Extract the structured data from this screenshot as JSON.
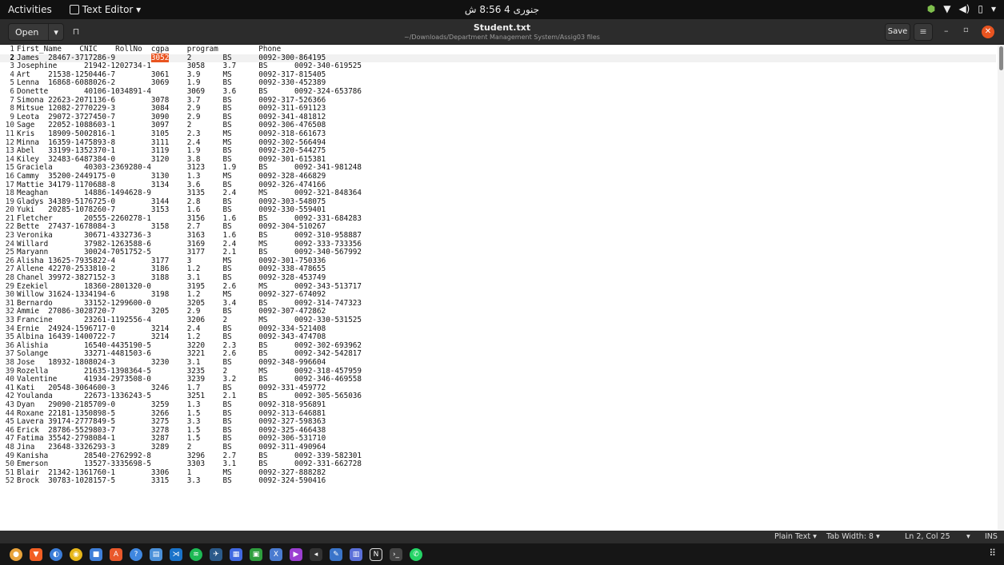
{
  "topbar": {
    "activities": "Activities",
    "app_name": "Text Editor ▾",
    "clock": "جنوری 4  8:56 ش",
    "tray_icons": [
      "shield-icon",
      "wifi-icon",
      "volume-icon",
      "battery-icon",
      "menu-arrow-icon"
    ]
  },
  "headerbar": {
    "open_label": "Open",
    "title": "Student.txt",
    "path": "~/Downloads/Department Management System/Assig03 files",
    "save_label": "Save"
  },
  "editor": {
    "lines": [
      "First_Name    CNIC    RollNo  cgpa    program         Phone",
      "James  28467-3717286-9        3052    2       BS      0092-300-864195",
      "Josephine      21942-1202734-1        3058    3.7     BS      0092-340-619525",
      "Art    21538-1250446-7        3061    3.9     MS      0092-317-815405",
      "Lenna  16868-6088026-2        3069    1.9     BS      0092-330-452389",
      "Donette        40106-1034891-4        3069    3.6     BS      0092-324-653786",
      "Simona 22623-2071136-6        3078    3.7     BS      0092-317-526366",
      "Mitsue 12082-2770229-3        3084    2.9     BS      0092-311-691123",
      "Leota  29072-3727450-7        3090    2.9     BS      0092-341-481812",
      "Sage   22052-1088603-1        3097    2       BS      0092-306-476508",
      "Kris   18909-5002816-1        3105    2.3     MS      0092-318-661673",
      "Minna  16359-1475893-8        3111    2.4     MS      0092-302-566494",
      "Abel   33199-1352370-1        3119    1.9     BS      0092-320-544275",
      "Kiley  32483-6487384-0        3120    3.8     BS      0092-301-615381",
      "Graciela       40303-2369280-4        3123    1.9     BS      0092-341-981248",
      "Cammy  35200-2449175-0        3130    1.3     MS      0092-328-466829",
      "Mattie 34179-1170688-8        3134    3.6     BS      0092-326-474166",
      "Meaghan        14886-1494628-9        3135    2.4     MS      0092-321-848364",
      "Gladys 34389-5176725-0        3144    2.8     BS      0092-303-548075",
      "Yuki   20285-1078260-7        3153    1.6     BS      0092-330-559401",
      "Fletcher       20555-2260278-1        3156    1.6     BS      0092-331-684283",
      "Bette  27437-1678084-3        3158    2.7     BS      0092-304-510267",
      "Veronika       30671-4332736-3        3163    1.6     BS      0092-310-958887",
      "Willard        37982-1263588-6        3169    2.4     MS      0092-333-733356",
      "Maryann        30024-7051752-5        3177    2.1     BS      0092-340-567992",
      "Alisha 13625-7935822-4        3177    3       MS      0092-301-750336",
      "Allene 42270-2533810-2        3186    1.2     BS      0092-338-478655",
      "Chanel 39972-3827152-3        3188    3.1     BS      0092-328-453749",
      "Ezekiel        18360-2801320-0        3195    2.6     MS      0092-343-513717",
      "Willow 31624-1334194-6        3198    1.2     MS      0092-327-674092",
      "Bernardo       33152-1299600-0        3205    3.4     BS      0092-314-747323",
      "Ammie  27086-3028720-7        3205    2.9     BS      0092-307-472862",
      "Francine       23261-1192556-4        3206    2       MS      0092-330-531525",
      "Ernie  24924-1596717-0        3214    2.4     BS      0092-334-521408",
      "Albina 16439-1400722-7        3214    1.2     BS      0092-343-474708",
      "Alishia        16540-4435190-5        3220    2.3     BS      0092-302-693962",
      "Solange        33271-4481503-6        3221    2.6     BS      0092-342-542817",
      "Jose   18932-1808024-3        3230    3.1     BS      0092-348-996604",
      "Rozella        21635-1398364-5        3235    2       MS      0092-318-457959",
      "Valentine      41934-2973508-0        3239    3.2     BS      0092-346-469558",
      "Kati   20548-3064600-3        3246    1.7     BS      0092-331-459772",
      "Youlanda       22673-1336243-5        3251    2.1     BS      0092-305-565036",
      "Dyan   29090-2185709-0        3259    1.3     BS      0092-318-956891",
      "Roxane 22181-1350898-5        3266    1.5     BS      0092-313-646881",
      "Lavera 39174-2777849-5        3275    3.3     BS      0092-327-598363",
      "Erick  28786-5529803-7        3278    1.5     BS      0092-325-466438",
      "Fatima 35542-2798084-1        3287    1.5     BS      0092-306-531710",
      "Jina   23648-3326293-3        3289    2       BS      0092-311-490964",
      "Kanisha        28540-2762992-8        3296    2.7     BS      0092-339-582301",
      "Emerson        13527-3335698-5        3303    3.1     BS      0092-331-662728",
      "Blair  21342-1361760-1        3306    1       MS      0092-327-888282",
      "Brock  30783-1028157-5        3315    3.3     BS      0092-324-590416"
    ],
    "current_line": 2,
    "selected_text": "3052"
  },
  "statusbar": {
    "language": "Plain Text ▾",
    "tab_width": "Tab Width: 8 ▾",
    "cursor": "Ln 2, Col 25",
    "mode": "INS"
  },
  "dock": {
    "apps": [
      "chrome-icon",
      "brave-icon",
      "files-icon",
      "camera-icon",
      "notes-icon",
      "software-icon",
      "help-icon",
      "docs-icon",
      "vscode-icon",
      "spotify-icon",
      "steam-icon",
      "calendar-icon",
      "circuit-icon",
      "spreadsheet-icon",
      "media-icon",
      "nav-icon",
      "text-editor-icon",
      "calc-icon",
      "notion-icon",
      "terminal-icon",
      "whatsapp-icon"
    ]
  },
  "colors": {
    "accent": "#e95420",
    "editor_bg": "#ffffff",
    "headerbar_bg": "#2c2c2c",
    "topbar_bg": "#111111"
  }
}
